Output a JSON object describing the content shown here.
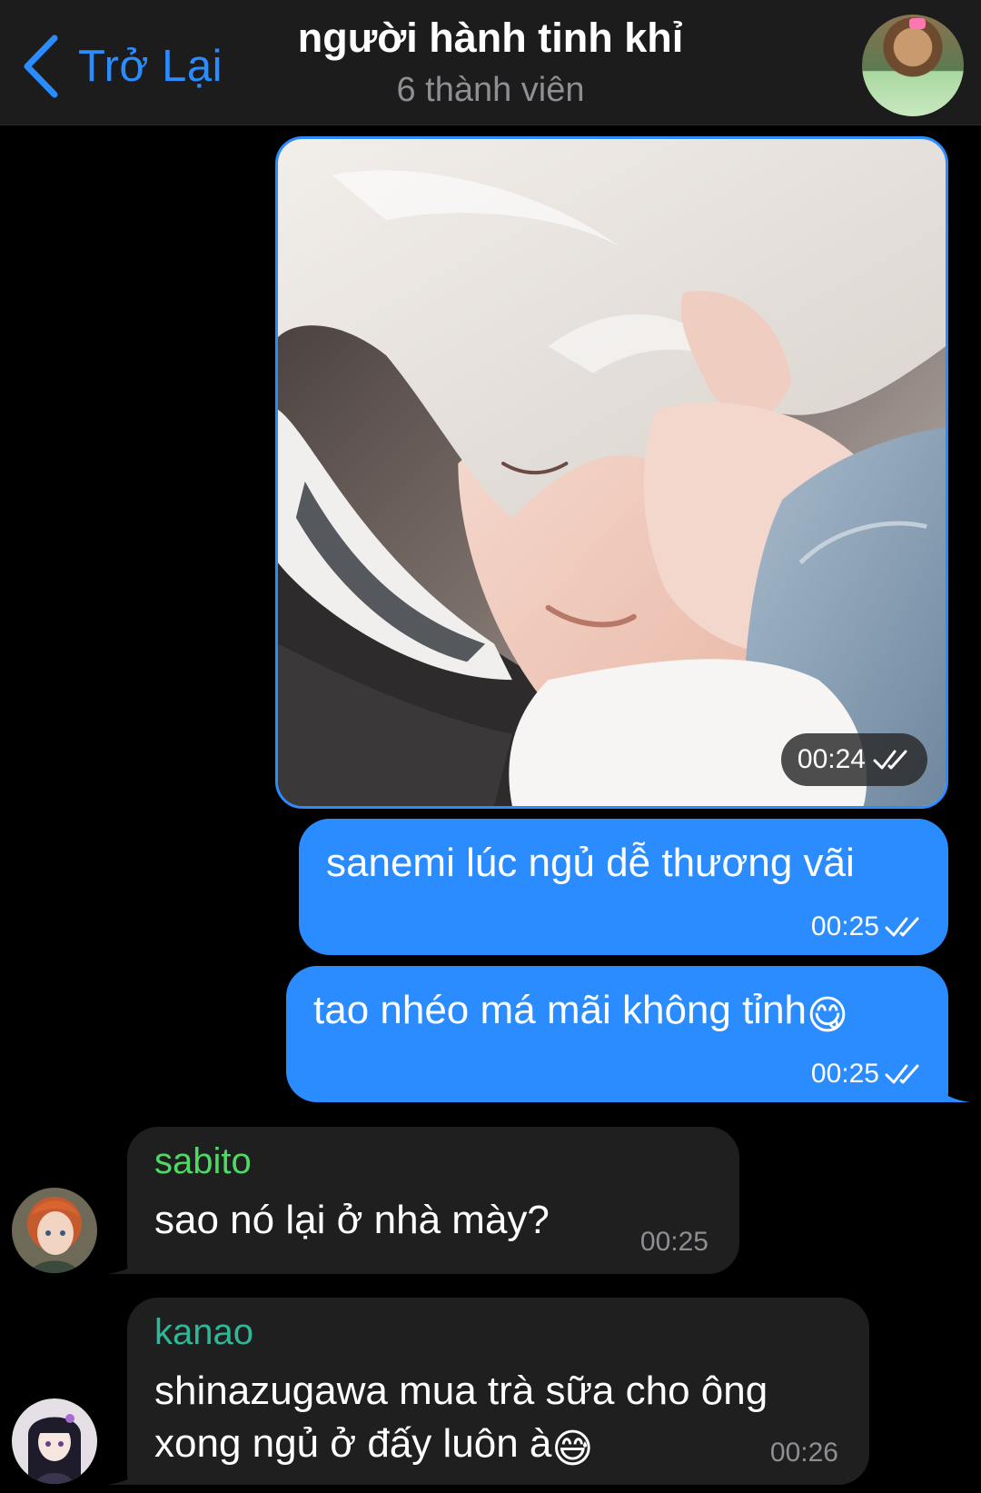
{
  "header": {
    "back_label": "Trở Lại",
    "title": "người hành tinh khỉ",
    "subtitle": "6 thành viên",
    "accent_color": "#2a8cff"
  },
  "messages": [
    {
      "type": "photo",
      "direction": "outgoing",
      "time": "00:24",
      "status": "read"
    },
    {
      "type": "text",
      "direction": "outgoing",
      "text": "sanemi lúc ngủ dễ thương vãi",
      "time": "00:25",
      "status": "read"
    },
    {
      "type": "text",
      "direction": "outgoing",
      "text": "tao nhéo má mãi không tỉnh",
      "emoji": "😋",
      "time": "00:25",
      "status": "read"
    },
    {
      "type": "text",
      "direction": "incoming",
      "sender": "sabito",
      "sender_color": "#4cd964",
      "text": "sao nó lại ở nhà mày?",
      "time": "00:25"
    },
    {
      "type": "text",
      "direction": "incoming",
      "sender": "kanao",
      "sender_color": "#2fb79a",
      "text_line1": "shinazugawa mua trà sữa cho ông",
      "text_line2": "xong ngủ ở đấy luôn à",
      "emoji": "😅",
      "time": "00:26"
    }
  ],
  "colors": {
    "outgoing_bubble": "#2a8cff",
    "incoming_bubble": "#1f1f20",
    "background": "#000000",
    "header_bg": "#1c1c1d"
  }
}
